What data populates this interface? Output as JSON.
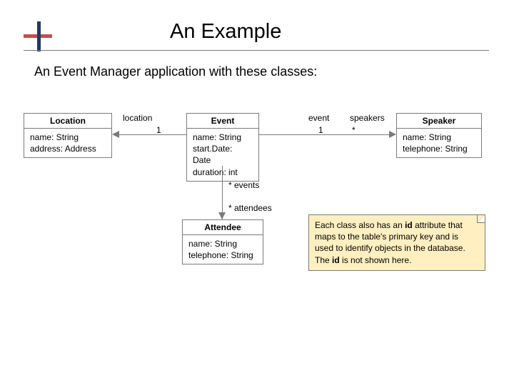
{
  "title": "An Example",
  "subtitle": "An Event Manager application with these classes:",
  "classes": {
    "location": {
      "name": "Location",
      "attrs": [
        "name: String",
        "address: Address"
      ]
    },
    "event": {
      "name": "Event",
      "attrs": [
        "name: String",
        "start.Date: Date",
        "duration: int"
      ]
    },
    "speaker": {
      "name": "Speaker",
      "attrs": [
        "name: String",
        "telephone: String"
      ]
    },
    "attendee": {
      "name": "Attendee",
      "attrs": [
        "name: String",
        "telephone: String"
      ]
    }
  },
  "assoc": {
    "loc_event": {
      "role_left": "location",
      "mult_left": "1"
    },
    "event_speaker": {
      "role_left": "event",
      "mult_left": "1",
      "role_right": "speakers",
      "mult_right": "*"
    },
    "event_attendee": {
      "mult_events": "* events",
      "mult_attendees": "* attendees"
    }
  },
  "note": {
    "t1": "Each class also has an ",
    "b1": "id",
    "t2": " attribute that maps to the table's primary key and is used to identify objects in the database. The ",
    "b2": "id",
    "t3": " is not shown here."
  }
}
